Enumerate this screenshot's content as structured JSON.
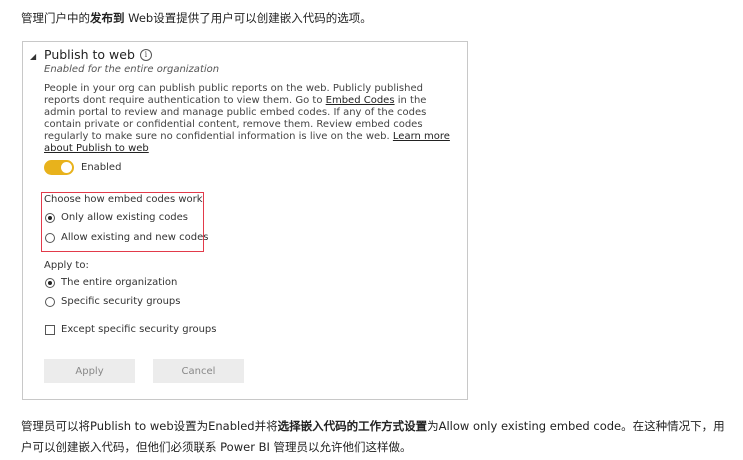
{
  "intro": {
    "before": "管理门户中的",
    "bold": "发布到",
    "after": " Web设置提供了用户可以创建嵌入代码的选项。"
  },
  "panel": {
    "title": "Publish to web",
    "info_icon": "i",
    "subtitle": "Enabled for the entire organization",
    "desc_1": "People in your org can publish public reports on the web. Publicly published reports dont require authentication to view them. Go to ",
    "link_embed": "Embed Codes",
    "desc_2": " in the admin portal to review and manage public embed codes. If any of the codes contain private or confidential content, remove them. Review embed codes regularly to make sure no confidential information is live on the web. ",
    "link_learn": "Learn more about Publish to web",
    "toggle_label": "Enabled",
    "toggle_on": true,
    "embed_heading": "Choose how embed codes work",
    "embed_opt1": "Only allow existing codes",
    "embed_opt2": "Allow existing and new codes",
    "embed_selected": "Only allow existing codes",
    "apply_heading": "Apply to:",
    "apply_opt1": "The entire organization",
    "apply_opt2": "Specific security groups",
    "apply_selected": "The entire organization",
    "except_label": "Except specific security groups",
    "except_checked": false,
    "apply_button": "Apply",
    "cancel_button": "Cancel",
    "accent_color": "#e8b21c",
    "highlight_color": "#e23a4a"
  },
  "outro": {
    "p1": "管理员可以将Publish to web设置为Enabled并将",
    "bold": "选择嵌入代码的工作方式设置",
    "p2": "为Allow only existing embed code。在这种情况下，用户可以创建嵌入代码，但他们必须联系 Power BI 管理员以允许他们这样做。"
  }
}
